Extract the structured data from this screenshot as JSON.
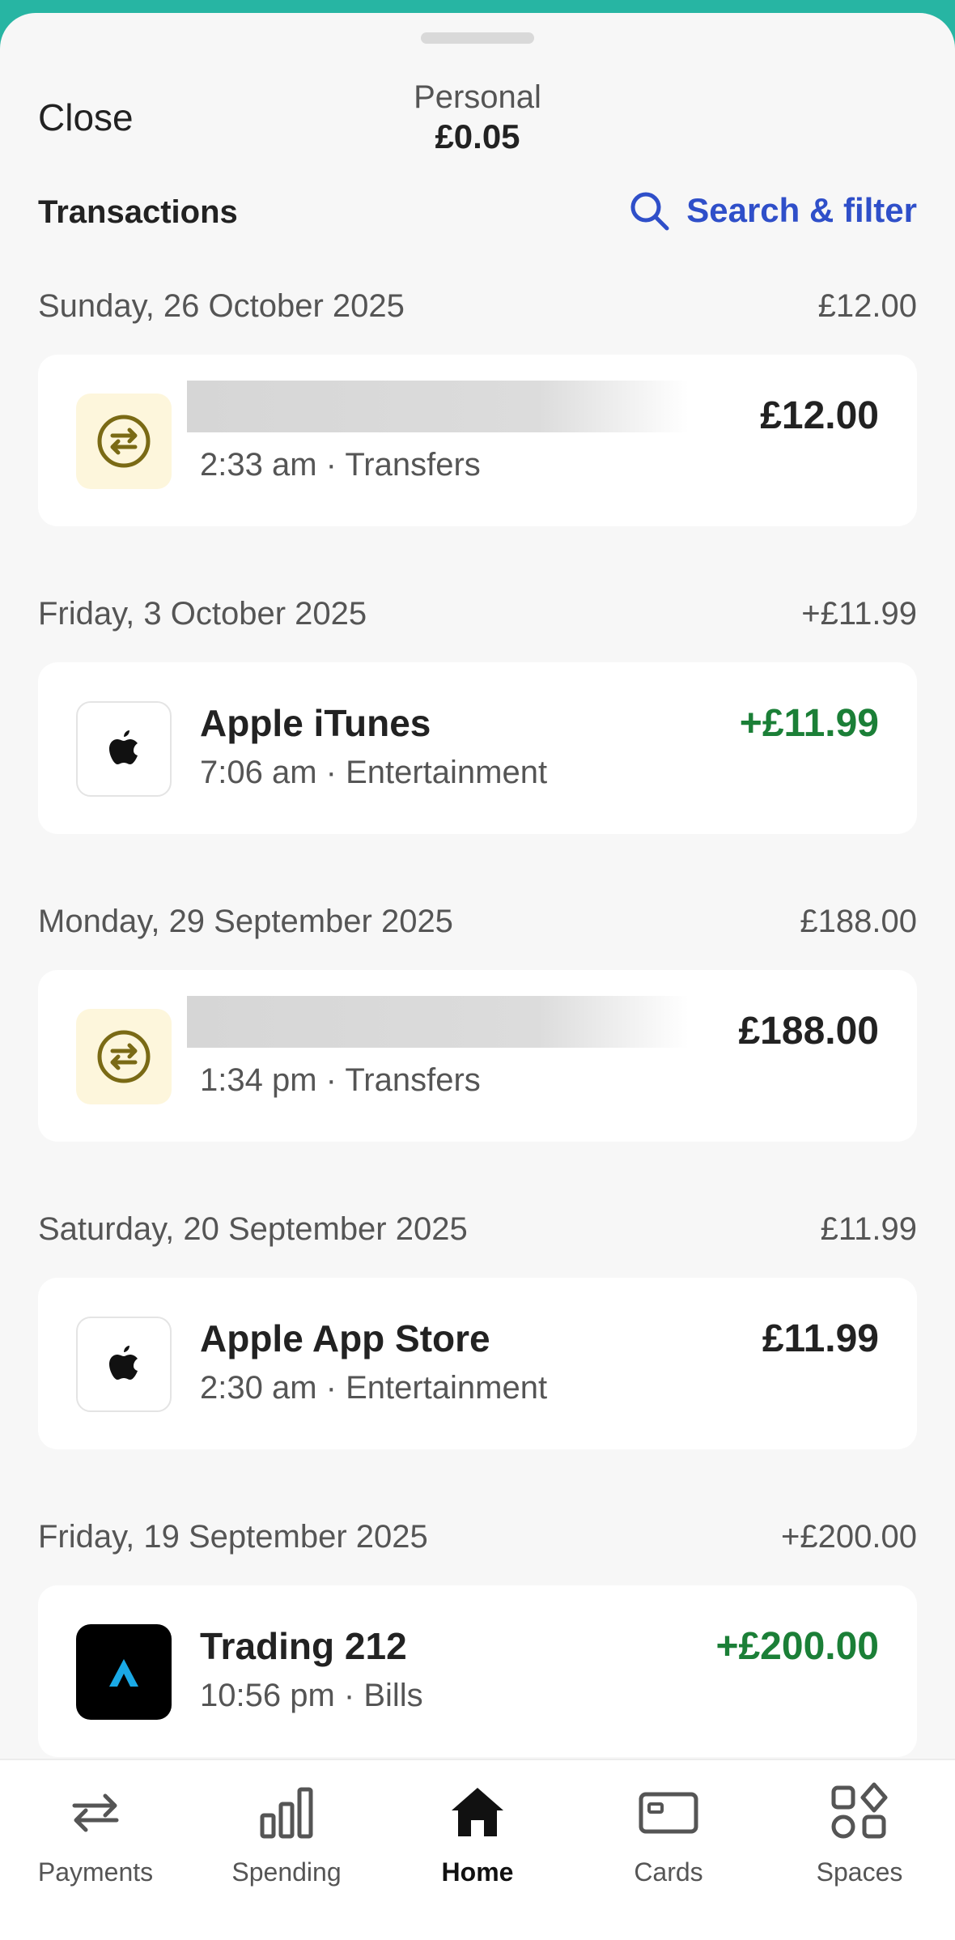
{
  "header": {
    "close_label": "Close",
    "account_name": "Personal",
    "account_balance": "£0.05",
    "section_title": "Transactions",
    "search_label": "Search & filter"
  },
  "colors": {
    "brand_teal": "#27b5a3",
    "link_blue": "#2f4fc9",
    "credit_green": "#1b7f37",
    "transfer_icon_bg": "#fdf6dc",
    "transfer_icon_fg": "#7a6a15"
  },
  "groups": [
    {
      "date": "Sunday, 26 October 2025",
      "total": "£12.00",
      "tx": {
        "icon": "transfer-icon",
        "name": "",
        "time": "2:33 am · Transfers",
        "amount": "£12.00",
        "credit": false,
        "redacted": true
      }
    },
    {
      "date": "Friday, 3 October 2025",
      "total": "+£11.99",
      "tx": {
        "icon": "apple-logo-icon",
        "name": "Apple iTunes",
        "time": "7:06 am · Entertainment",
        "amount": "+£11.99",
        "credit": true,
        "redacted": false
      }
    },
    {
      "date": "Monday, 29 September 2025",
      "total": "£188.00",
      "tx": {
        "icon": "transfer-icon",
        "name": "",
        "time": "1:34 pm · Transfers",
        "amount": "£188.00",
        "credit": false,
        "redacted": true
      }
    },
    {
      "date": "Saturday, 20 September 2025",
      "total": "£11.99",
      "tx": {
        "icon": "apple-logo-icon",
        "name": "Apple App Store",
        "time": "2:30 am · Entertainment",
        "amount": "£11.99",
        "credit": false,
        "redacted": false
      }
    },
    {
      "date": "Friday, 19 September 2025",
      "total": "+£200.00",
      "tx": {
        "icon": "trading-212-logo-icon",
        "name": "Trading 212",
        "time": "10:56 pm · Bills",
        "amount": "+£200.00",
        "credit": true,
        "redacted": false
      }
    }
  ],
  "tabs": [
    {
      "label": "Payments",
      "icon": "payments-arrows-icon",
      "active": false
    },
    {
      "label": "Spending",
      "icon": "bar-chart-icon",
      "active": false
    },
    {
      "label": "Home",
      "icon": "home-icon",
      "active": true
    },
    {
      "label": "Cards",
      "icon": "card-icon",
      "active": false
    },
    {
      "label": "Spaces",
      "icon": "spaces-grid-icon",
      "active": false
    }
  ]
}
